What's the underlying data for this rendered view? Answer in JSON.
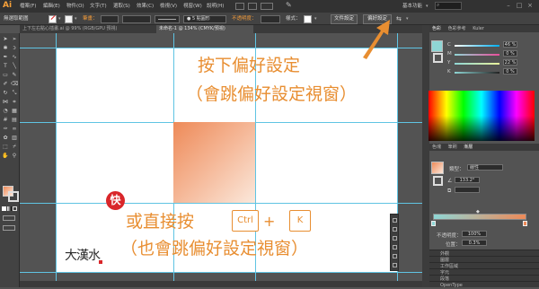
{
  "app": {
    "logo": "Ai"
  },
  "menubar": {
    "items": [
      "檔案(F)",
      "編輯(E)",
      "物件(O)",
      "文字(T)",
      "選取(S)",
      "效果(C)",
      "檢視(V)",
      "視窗(W)",
      "說明(H)"
    ],
    "workspace": "基本功能"
  },
  "control_bar": {
    "selection_label": "無選取範圍",
    "stroke_label": "筆畫：",
    "brush_value": "5 點圓形",
    "opacity_label": "不透明度：",
    "style_label": "樣式：",
    "doc_setup_button": "文件設定",
    "prefs_button": "偏好設定"
  },
  "tabs": [
    {
      "label": "上下左右點心插畫.ai @ 99% (RGB/GPU 預視)",
      "active": false
    },
    {
      "label": "未命名-1 @ 134% (CMYK/預視)",
      "active": true
    }
  ],
  "canvas": {
    "line1": "按下偏好設定",
    "line2": "（會跳偏好設定視窗）",
    "kuai": "快",
    "line3": "或直接按",
    "key1": "Ctrl",
    "plus": "+",
    "key2": "K",
    "line4": "（也會跳偏好設定視窗）",
    "logo_text": "大漢水"
  },
  "color_panel": {
    "tabs": [
      "色彩",
      "色彩參考",
      "Kuler"
    ],
    "channels": [
      {
        "label": "C",
        "value": "46 %"
      },
      {
        "label": "M",
        "value": "0 %"
      },
      {
        "label": "Y",
        "value": "22 %"
      },
      {
        "label": "K",
        "value": "0 %"
      }
    ]
  },
  "gradient_panel": {
    "tabs": [
      "色塊",
      "筆刷",
      "漸層"
    ],
    "type_label": "類型：",
    "type_value": "線性",
    "angle_value": "133.2°",
    "opacity_label": "不透明度：",
    "opacity_value": "100%",
    "position_label": "位置：",
    "position_value": "0.3%"
  },
  "bottom_panels": [
    "外觀",
    "圖層",
    "工作區域",
    "字元",
    "段落",
    "OpenType"
  ],
  "colors": {
    "accent_orange": "#e88e31",
    "kuai_red": "#d9262a",
    "guide_cyan": "#5fc4e3",
    "gradient_start": "#ee8a58",
    "gradient_end": "#fbe8db"
  }
}
